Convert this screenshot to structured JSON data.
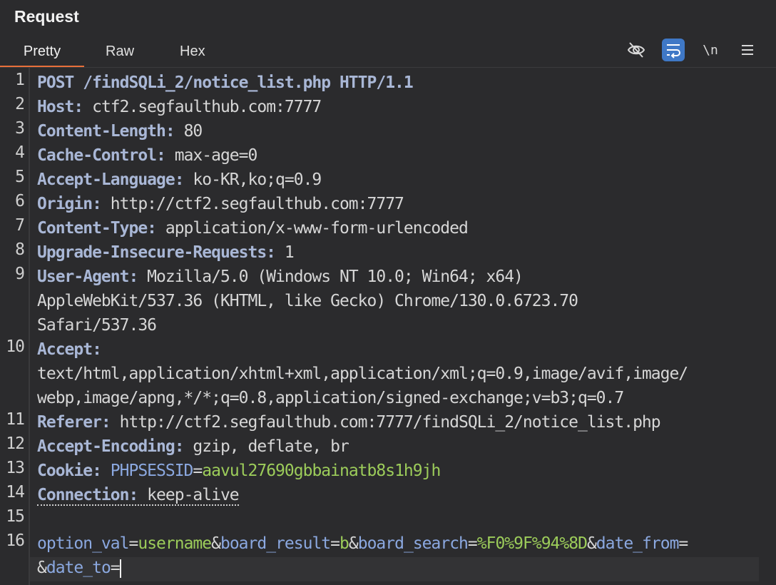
{
  "panel": {
    "title": "Request"
  },
  "tabs": [
    {
      "label": "Pretty"
    },
    {
      "label": "Raw"
    },
    {
      "label": "Hex"
    }
  ],
  "toolbar": {
    "hide_icon": "eye-slash-icon",
    "wrap_icon": "text-wrap-icon",
    "newline_label": "\\n",
    "menu_icon": "hamburger-icon"
  },
  "lines": {
    "n1": "1",
    "n2": "2",
    "n3": "3",
    "n4": "4",
    "n5": "5",
    "n6": "6",
    "n7": "7",
    "n8": "8",
    "n9": "9",
    "n10": "10",
    "n11": "11",
    "n12": "12",
    "n13": "13",
    "n14": "14",
    "n15": "15",
    "n16": "16"
  },
  "request": {
    "request_line": "POST /findSQLi_2/notice_list.php HTTP/1.1",
    "host_name": "Host:",
    "host_value": " ctf2.segfaulthub.com:7777",
    "cl_name": "Content-Length:",
    "cl_value": " 80",
    "cc_name": "Cache-Control:",
    "cc_value": " max-age=0",
    "al_name": "Accept-Language:",
    "al_value": " ko-KR,ko;q=0.9",
    "origin_name": "Origin:",
    "origin_value": " http://ctf2.segfaulthub.com:7777",
    "ct_name": "Content-Type:",
    "ct_value": " application/x-www-form-urlencoded",
    "uir_name": "Upgrade-Insecure-Requests:",
    "uir_value": " 1",
    "ua_name": "User-Agent:",
    "ua_value_1": " Mozilla/5.0 (Windows NT 10.0; Win64; x64)",
    "ua_value_2": "AppleWebKit/537.36 (KHTML, like Gecko) Chrome/130.0.6723.70",
    "ua_value_3": "Safari/537.36",
    "accept_name": "Accept:",
    "accept_value_1": "text/html,application/xhtml+xml,application/xml;q=0.9,image/avif,image/",
    "accept_value_2": "webp,image/apng,*/*;q=0.8,application/signed-exchange;v=b3;q=0.7",
    "referer_name": "Referer:",
    "referer_value": " http://ctf2.segfaulthub.com:7777/findSQLi_2/notice_list.php",
    "ae_name": "Accept-Encoding:",
    "ae_value": " gzip, deflate, br",
    "cookie_name": "Cookie:",
    "cookie_key": " PHPSESSID",
    "cookie_eq": "=",
    "cookie_val": "aavul27690gbbainatb8s1h9jh",
    "conn_name": "Connection:",
    "conn_value": " keep-alive"
  },
  "body": {
    "k1": "option_val",
    "e1": "=",
    "v1": "username",
    "a1": "&",
    "k2": "board_result",
    "e2": "=",
    "v2": "b",
    "a2": "&",
    "k3": "board_search",
    "e3": "=",
    "v3": "%F0%9F%94%8D",
    "a3": "&",
    "k4": "date_from",
    "e4": "=",
    "a4": "&",
    "k5": "date_to",
    "e5": "="
  },
  "colors": {
    "background": "#2b2b2d",
    "active_tab_underline": "#e8703a",
    "header_name": "#a9b7d6",
    "param_key": "#8ba8e0",
    "param_value": "#9ccc5a",
    "toggle_on": "#3f78c6"
  }
}
